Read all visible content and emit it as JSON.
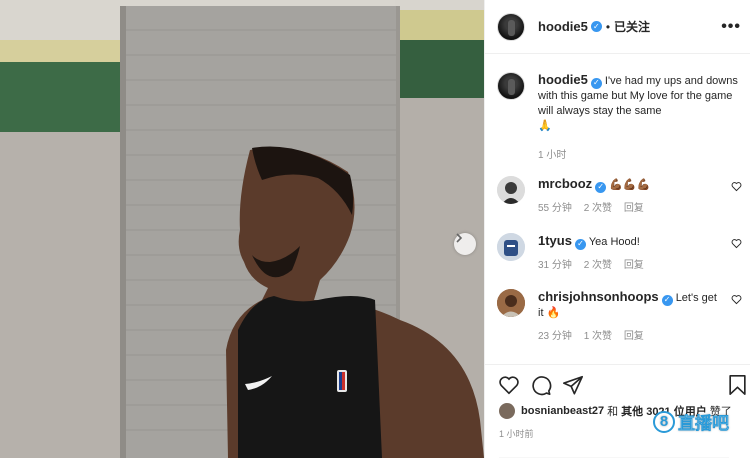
{
  "post": {
    "author": "hoodie5",
    "follow_state": "已关注",
    "more_label": "•••",
    "caption": {
      "username": "hoodie5",
      "text": "I've had my ups and downs with this game but My love for the game will always stay the same",
      "emoji": "🙏",
      "time": "1 小时"
    },
    "comments": [
      {
        "username": "mrcbooz",
        "text": "💪🏾💪🏾💪🏾",
        "time": "55 分钟",
        "likes": "2 次赞",
        "reply": "回复"
      },
      {
        "username": "1tyus",
        "text": "Yea Hood!",
        "time": "31 分钟",
        "likes": "2 次赞",
        "reply": "回复"
      },
      {
        "username": "chrisjohnsonhoops",
        "text": "Let's get it 🔥",
        "time": "23 分钟",
        "likes": "1 次赞",
        "reply": "回复"
      }
    ],
    "liked_by": {
      "user": "bosnianbeast27",
      "connector": "和",
      "others": "其他 3021 位用户",
      "suffix": "赞了"
    },
    "post_time": "1 小时前"
  },
  "watermark": {
    "badge": "8",
    "text": "直播吧"
  },
  "icons": {
    "next": "chevron-right-icon",
    "like": "heart-icon",
    "comment": "comment-bubble-icon",
    "share": "paper-plane-icon",
    "save": "bookmark-icon",
    "verified": "verified-badge-icon"
  },
  "colors": {
    "verified": "#3897f0",
    "meta_text": "#8e8e8e",
    "watermark": "#2a9ad8"
  }
}
